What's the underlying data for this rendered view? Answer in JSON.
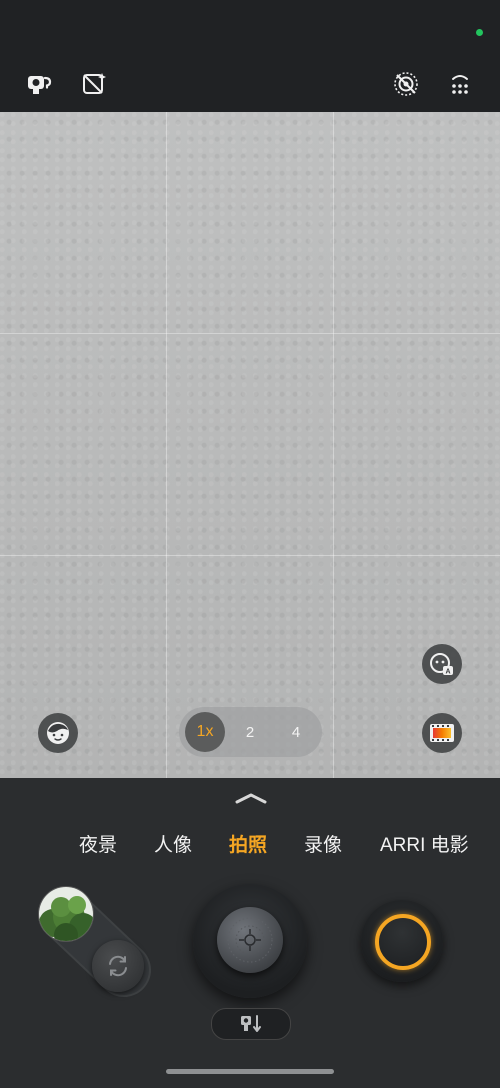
{
  "status_bar": {
    "indicator_color": "#22c55e"
  },
  "top_bar": {
    "icons": [
      "camera-kit-icon",
      "ai-enhance-off-icon",
      "live-photo-off-icon",
      "more-settings-icon"
    ]
  },
  "viewfinder": {
    "grid": "3x3",
    "left_button_icon": "face-retouch-icon",
    "right_upper_button_icon": "ai-scene-icon",
    "right_lower_button_icon": "film-filter-icon"
  },
  "zoom": {
    "options": [
      "1x",
      "2",
      "4"
    ],
    "selected": "1x"
  },
  "modes": {
    "items": [
      "夜景",
      "人像",
      "拍照",
      "录像",
      "ARRI 电影"
    ],
    "selected": "拍照"
  },
  "controls": {
    "gallery_thumbnail_icon": "gallery-thumbnail",
    "flip_camera_icon": "flip-camera-icon",
    "mode_dial_icon": "mode-dial-icon",
    "shutter_icon": "shutter-button",
    "lens_switch_icon": "lens-switch-icon"
  },
  "colors": {
    "accent": "#f5a623",
    "panel_bg": "#2b2d2f",
    "bar_bg": "#202224"
  }
}
